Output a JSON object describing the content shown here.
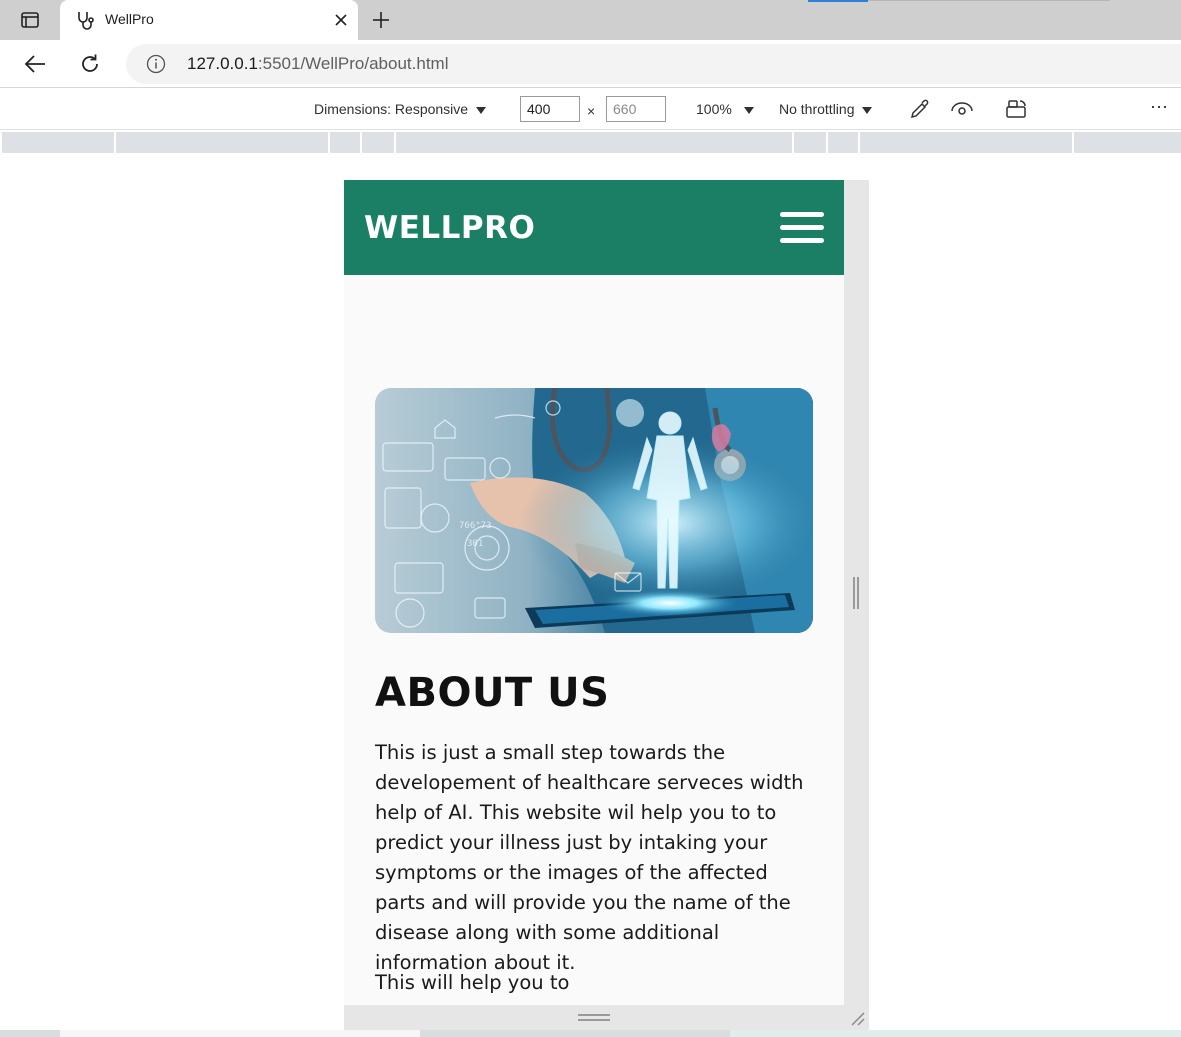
{
  "browser": {
    "tab": {
      "title": "WellPro",
      "favicon": "stethoscope-icon",
      "close_icon": "close-icon"
    },
    "new_tab_icon": "plus-icon",
    "nav": {
      "back_icon": "arrow-left-icon",
      "reload_icon": "reload-icon",
      "info_icon": "info-icon"
    },
    "url": {
      "host": "127.0.0.1",
      "rest": ":5501/WellPro/about.html"
    }
  },
  "devtools_toolbar": {
    "dimensions_label": "Dimensions: Responsive",
    "width_value": "400",
    "height_value": "660",
    "times": "×",
    "zoom": "100%",
    "throttling": "No throttling",
    "more": "⋯",
    "icons": [
      "eyedropper-icon",
      "vision-icon",
      "rotate-device-icon"
    ]
  },
  "site": {
    "logo": "WELLPRO",
    "menu_icon": "hamburger-icon",
    "hero_image": "ai-healthcare-hologram-image",
    "about_title": "ABOUT US",
    "about_paragraph": "This is just a small step towards the developement of healthcare serveces width help of AI. This website wil help you to to predict your illness just by intaking your symptoms or the images of the affected parts and will provide you the name of the disease along with some additional information about it.",
    "about_paragraph_2": "This will help you to"
  },
  "colors": {
    "header_green": "#1b7f65",
    "tabstrip": "#cfcfcf",
    "ruler": "#dde1e5"
  }
}
